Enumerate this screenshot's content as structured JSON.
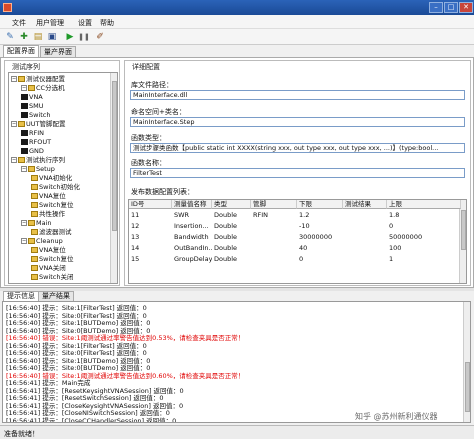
{
  "window": {
    "title": ""
  },
  "menu": [
    "文件",
    "用户管理",
    "设置",
    "帮助"
  ],
  "toolbar": [
    {
      "icon": "new-icon",
      "glyph": "✎"
    },
    {
      "icon": "add-icon",
      "glyph": "✚"
    },
    {
      "icon": "open-icon",
      "glyph": "▤"
    },
    {
      "icon": "save-icon",
      "glyph": "▣"
    },
    {
      "icon": "run-icon",
      "glyph": "▶"
    },
    {
      "icon": "pause-icon",
      "glyph": "❚❚"
    },
    {
      "icon": "settings-icon",
      "glyph": "✐"
    }
  ],
  "tabs": [
    "配置界面",
    "量产界面"
  ],
  "left_group_title": "测试序列",
  "tree": [
    {
      "level": 1,
      "exp": "−",
      "icon": "folder",
      "label": "测试仪器配置"
    },
    {
      "level": 2,
      "exp": "−",
      "icon": "folder",
      "label": "CC分选机"
    },
    {
      "level": 2,
      "exp": "",
      "icon": "inst",
      "label": "VNA"
    },
    {
      "level": 2,
      "exp": "",
      "icon": "inst",
      "label": "SMU"
    },
    {
      "level": 2,
      "exp": "",
      "icon": "inst",
      "label": "Switch"
    },
    {
      "level": 1,
      "exp": "−",
      "icon": "folder",
      "label": "UUT管脚配置"
    },
    {
      "level": 2,
      "exp": "",
      "icon": "inst",
      "label": "RFIN"
    },
    {
      "level": 2,
      "exp": "",
      "icon": "inst",
      "label": "RFOUT"
    },
    {
      "level": 2,
      "exp": "",
      "icon": "inst",
      "label": "GND"
    },
    {
      "level": 1,
      "exp": "−",
      "icon": "folder",
      "label": "测试执行序列"
    },
    {
      "level": 2,
      "exp": "−",
      "icon": "folder",
      "label": "Setup"
    },
    {
      "level": 3,
      "exp": "",
      "icon": "folder",
      "label": "VNA初始化"
    },
    {
      "level": 3,
      "exp": "",
      "icon": "folder",
      "label": "Switch初始化"
    },
    {
      "level": 3,
      "exp": "",
      "icon": "folder",
      "label": "VNA复位"
    },
    {
      "level": 3,
      "exp": "",
      "icon": "folder",
      "label": "Switch复位"
    },
    {
      "level": 3,
      "exp": "",
      "icon": "folder",
      "label": "共性操作"
    },
    {
      "level": 2,
      "exp": "−",
      "icon": "folder",
      "label": "Main"
    },
    {
      "level": 3,
      "exp": "",
      "icon": "folder",
      "label": "滤波器测试"
    },
    {
      "level": 2,
      "exp": "−",
      "icon": "folder",
      "label": "Cleanup"
    },
    {
      "level": 3,
      "exp": "",
      "icon": "folder",
      "label": "VNA复位"
    },
    {
      "level": 3,
      "exp": "",
      "icon": "folder",
      "label": "Switch复位"
    },
    {
      "level": 3,
      "exp": "",
      "icon": "folder",
      "label": "VNA关闭"
    },
    {
      "level": 3,
      "exp": "",
      "icon": "folder",
      "label": "Switch关闭"
    }
  ],
  "right_group_title": "详细配置",
  "fields": [
    {
      "label": "库文件路径：",
      "value": "MainInterface.dll"
    },
    {
      "label": "命名空间+类名：",
      "value": "MainInterface.Step"
    },
    {
      "label": "函数类型：",
      "value": "测试步骤类函数【public static int XXXX(string xxx, out type xxx, out type xxx, ...)】(type:bool..."
    },
    {
      "label": "函数名称：",
      "value": "FilterTest"
    }
  ],
  "grid_title": "发布数据配置列表：",
  "grid": {
    "headers": [
      "ID号",
      "测量值名称",
      "类型",
      "管脚",
      "下限",
      "测试结果",
      "上限"
    ],
    "rows": [
      [
        "11",
        "SWR",
        "Double",
        "RFIN",
        "1.2",
        "",
        "1.8"
      ],
      [
        "12",
        "Insertion...",
        "Double",
        "",
        "-10",
        "",
        "0"
      ],
      [
        "13",
        "Bandwidth",
        "Double",
        "",
        "30000000",
        "",
        "50000000"
      ],
      [
        "14",
        "OutBandIn...",
        "Double",
        "",
        "40",
        "",
        "100"
      ],
      [
        "15",
        "GroupDelay",
        "Double",
        "",
        "0",
        "",
        "1"
      ]
    ]
  },
  "bottom_tabs": [
    "提示信息",
    "量产结果"
  ],
  "log": [
    {
      "text": "[16:56:40] 提示：Site:1[FilterTest] 返回值：0",
      "err": false
    },
    {
      "text": "[16:56:40] 提示：Site:0[FilterTest] 返回值：0",
      "err": false
    },
    {
      "text": "[16:56:40] 提示：Site:1[BUTDemo] 返回值：0",
      "err": false
    },
    {
      "text": "[16:56:40] 提示：Site:0[BUTDemo] 返回值：0",
      "err": false
    },
    {
      "text": "[16:56:40] 错误：Site:1阈测试通过率警告值达到0.53%，请检查夹具是否正常！",
      "err": true
    },
    {
      "text": "[16:56:40] 提示：Site:1[FilterTest] 返回值：0",
      "err": false
    },
    {
      "text": "[16:56:40] 提示：Site:0[FilterTest] 返回值：0",
      "err": false
    },
    {
      "text": "[16:56:40] 提示：Site:1[BUTDemo] 返回值：0",
      "err": false
    },
    {
      "text": "[16:56:40] 提示：Site:0[BUTDemo] 返回值：0",
      "err": false
    },
    {
      "text": "[16:56:40] 错误：Site:1阈测试通过率警告值达到0.60%，请检查夹具是否正常！",
      "err": true
    },
    {
      "text": "[16:56:41] 提示：Main完成",
      "err": false
    },
    {
      "text": "[16:56:41] 提示：[ResetKeysightVNASession] 返回值：0",
      "err": false
    },
    {
      "text": "[16:56:41] 提示：[ResetSwitchSession] 返回值：0",
      "err": false
    },
    {
      "text": "[16:56:41] 提示：[CloseKeysightVNASession] 返回值：0",
      "err": false
    },
    {
      "text": "[16:56:41] 提示：[CloseNISwitchSession] 返回值：0",
      "err": false
    },
    {
      "text": "[16:56:41] 提示：[CloseCCHandlerSession] 返回值：0",
      "err": false
    }
  ],
  "watermark": "知乎 @苏州新利通仪器",
  "status": "准备就绪！"
}
